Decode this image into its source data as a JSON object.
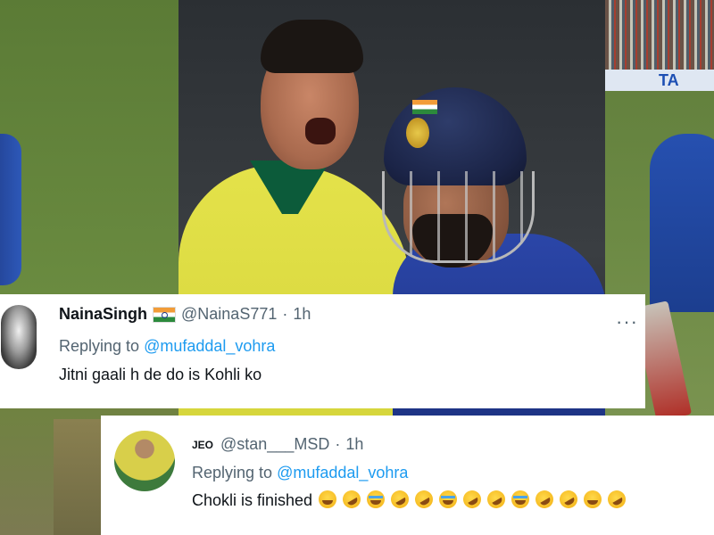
{
  "tweets": [
    {
      "display_name": "NainaSingh",
      "handle": "@NainaS771",
      "separator": "·",
      "time": "1h",
      "reply_prefix": "Replying to",
      "reply_to": "@mufaddal_vohra",
      "text": "Jitni gaali h de do is Kohli ko",
      "more_icon": "more-horizontal-icon"
    },
    {
      "display_name": "JEO",
      "handle": "@stan___MSD",
      "separator": "·",
      "time": "1h",
      "reply_prefix": "Replying to",
      "reply_to": "@mufaddal_vohra",
      "text": "Chokli is finished",
      "emojis": [
        "sweat-smile",
        "rofl",
        "loudly-crying",
        "rofl",
        "rofl",
        "loudly-crying",
        "rofl",
        "rofl",
        "loudly-crying",
        "rofl",
        "rofl",
        "sweat-smile",
        "rofl"
      ]
    }
  ],
  "background": {
    "ad_board_text": "TA"
  }
}
